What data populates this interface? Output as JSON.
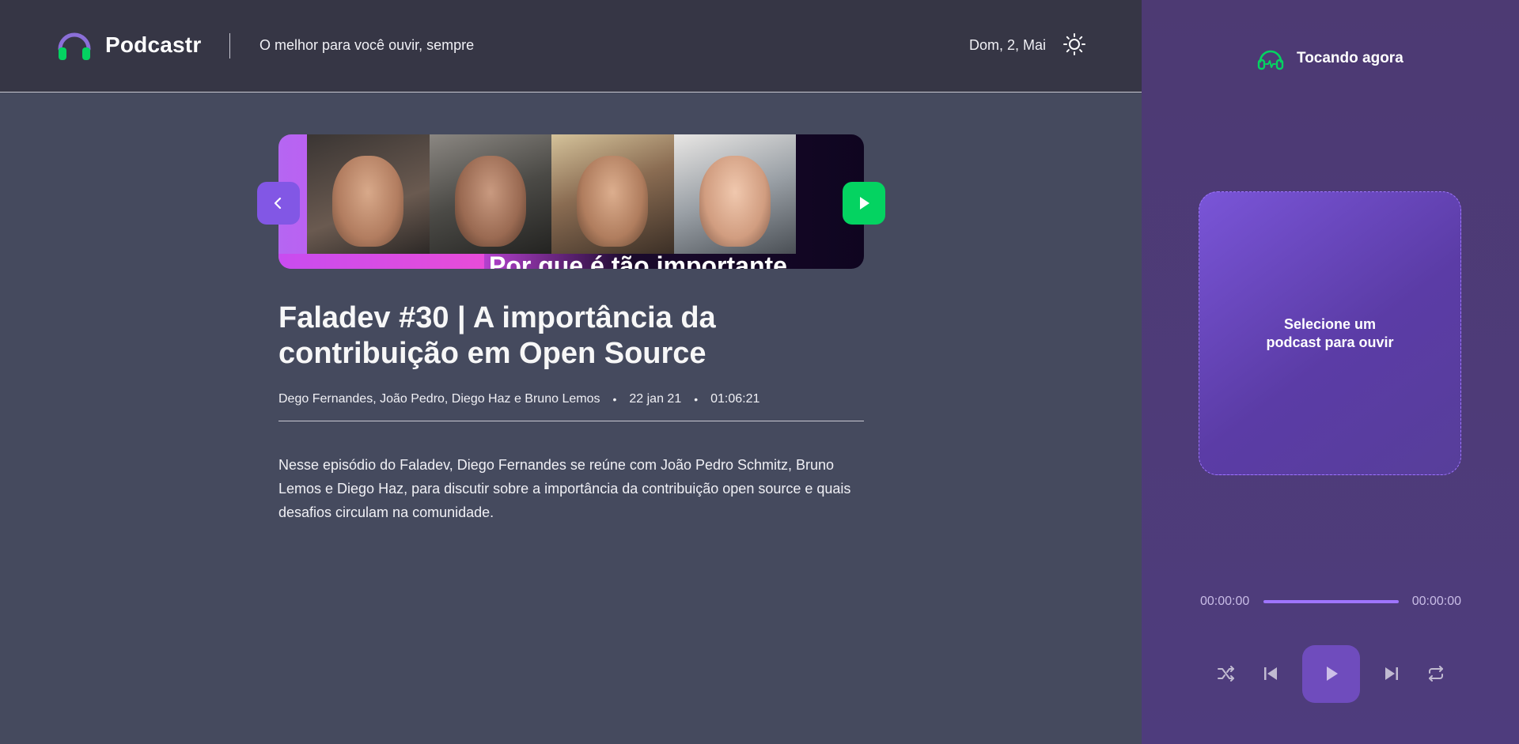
{
  "header": {
    "app_name": "Podcastr",
    "tagline": "O melhor para você ouvir, sempre",
    "date": "Dom, 2, Mai",
    "theme_icon": "sun-icon"
  },
  "episode": {
    "thumbnail_caption": "Por que é tão importante",
    "title": "Faladev #30 | A importância da contribuição em Open Source",
    "members": "Dego Fernandes, João Pedro, Diego Haz e Bruno Lemos",
    "published_at": "22 jan 21",
    "duration": "01:06:21",
    "description": "Nesse episódio do Faladev, Diego Fernandes se reúne com João Pedro Schmitz, Bruno Lemos e Diego Haz, para discutir sobre a importância da contribuição open source e quais desafios circulam na comunidade.",
    "separator": "•"
  },
  "player": {
    "heading": "Tocando agora",
    "empty_message": "Selecione um podcast para ouvir",
    "current_time": "00:00:00",
    "total_time": "00:00:00",
    "progress": 0
  },
  "colors": {
    "accent_purple": "#8257e5",
    "accent_green": "#04d361",
    "header_bg": "#363645",
    "main_bg": "#454a5e",
    "player_bg": "#4e3c7d"
  }
}
